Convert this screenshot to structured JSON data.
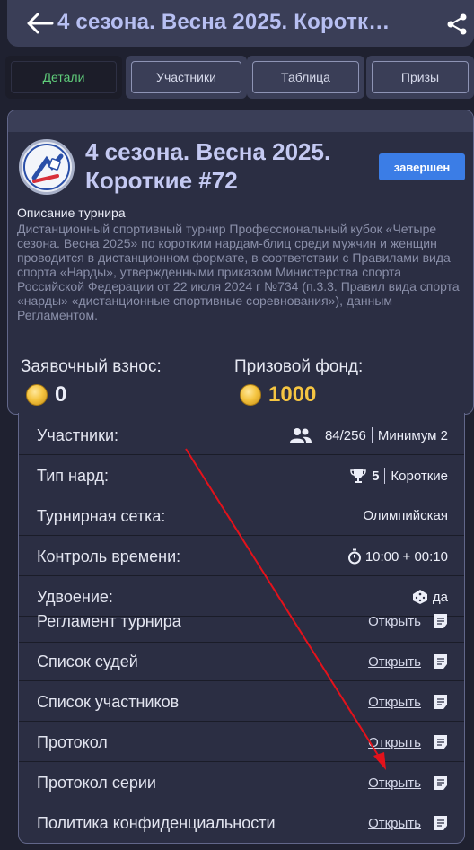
{
  "header": {
    "title": "4 сезона. Весна 2025. Коротк…",
    "back_icon": "arrow-left-icon",
    "share_icon": "share-icon"
  },
  "tabs": [
    {
      "label": "Детали",
      "active": true
    },
    {
      "label": "Участники",
      "active": false
    },
    {
      "label": "Таблица",
      "active": false
    },
    {
      "label": "Призы",
      "active": false
    }
  ],
  "tournament": {
    "title_line1": "4 сезона. Весна 2025.",
    "title_line2": "Короткие #72",
    "status": "завершен",
    "description_title": "Описание турнира",
    "description": "Дистанционный спортивный турнир Профессиональный кубок «Четыре сезона. Весна 2025» по коротким нардам-блиц среди мужчин и женщин проводится в дистанционном формате, в соответствии с Правилами вида спорта «Нарды», утвержденными приказом Министерства спорта Российской Федерации от 22 июля 2024 г №734 (п.3.3. Правил вида спорта «нарды» «дистанционные спортивные соревнования»), данным Регламентом.",
    "entry_fee_label": "Заявочный взнос:",
    "entry_fee_value": "0",
    "prize_fund_label": "Призовой фонд:",
    "prize_fund_value": "1000"
  },
  "details": {
    "participants_label": "Участники:",
    "participants_value": "84/256",
    "participants_min": "Минимум 2",
    "type_label": "Тип нард:",
    "type_count": "5",
    "type_value": "Короткие",
    "bracket_label": "Турнирная сетка:",
    "bracket_value": "Олимпийская",
    "time_label": "Контроль времени:",
    "time_value": "10:00 + 00:10",
    "doubling_label": "Удвоение:",
    "doubling_value": "да"
  },
  "documents": [
    {
      "label": "Регламент турнира",
      "link": "Открыть"
    },
    {
      "label": "Список судей",
      "link": "Открыть"
    },
    {
      "label": "Список участников",
      "link": "Открыть"
    },
    {
      "label": "Протокол",
      "link": "Открыть"
    },
    {
      "label": "Протокол серии",
      "link": "Открыть"
    },
    {
      "label": "Политика конфиденциальности",
      "link": "Открыть"
    }
  ],
  "colors": {
    "background": "#1f2130",
    "panel": "#2b2e43",
    "active_tab_text": "#5fcc7a",
    "status_badge": "#3b7de6",
    "prize_value": "#f5c542",
    "annotation_arrow": "#e3121b"
  }
}
